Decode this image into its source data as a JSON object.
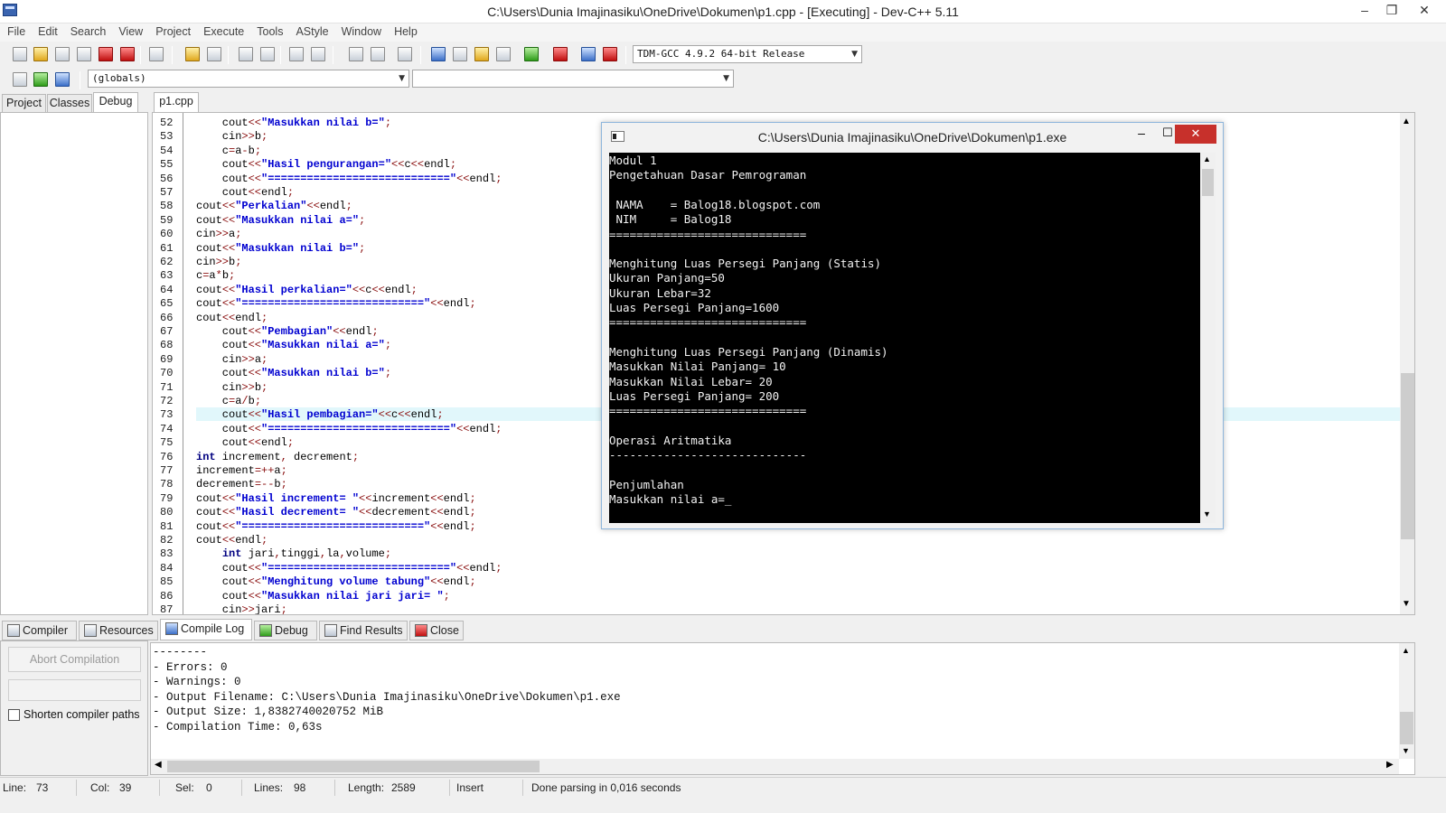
{
  "window": {
    "title": "C:\\Users\\Dunia Imajinasiku\\OneDrive\\Dokumen\\p1.cpp - [Executing] - Dev-C++ 5.11"
  },
  "menu": [
    "File",
    "Edit",
    "Search",
    "View",
    "Project",
    "Execute",
    "Tools",
    "AStyle",
    "Window",
    "Help"
  ],
  "toolbar": {
    "compiler_select": "TDM-GCC 4.9.2 64-bit Release",
    "scope_select": "(globals)",
    "symbol_select": ""
  },
  "left_tabs": [
    "Project",
    "Classes",
    "Debug"
  ],
  "editor": {
    "file_tab": "p1.cpp",
    "line_numbers": [
      "52",
      "53",
      "54",
      "55",
      "56",
      "57",
      "58",
      "59",
      "60",
      "61",
      "62",
      "63",
      "64",
      "65",
      "66",
      "67",
      "68",
      "69",
      "70",
      "71",
      "72",
      "73",
      "74",
      "75",
      "76",
      "77",
      "78",
      "79",
      "80",
      "81",
      "82",
      "83",
      "84",
      "85",
      "86",
      "87"
    ],
    "lines": [
      "    cout<<\"Masukkan nilai b=\";",
      "    cin>>b;",
      "    c=a-b;",
      "    cout<<\"Hasil pengurangan=\"<<c<<endl;",
      "    cout<<\"============================\"<<endl;",
      "    cout<<endl;",
      "cout<<\"Perkalian\"<<endl;",
      "cout<<\"Masukkan nilai a=\";",
      "cin>>a;",
      "cout<<\"Masukkan nilai b=\";",
      "cin>>b;",
      "c=a*b;",
      "cout<<\"Hasil perkalian=\"<<c<<endl;",
      "cout<<\"============================\"<<endl;",
      "cout<<endl;",
      "    cout<<\"Pembagian\"<<endl;",
      "    cout<<\"Masukkan nilai a=\";",
      "    cin>>a;",
      "    cout<<\"Masukkan nilai b=\";",
      "    cin>>b;",
      "    c=a/b;",
      "    cout<<\"Hasil pembagian=\"<<c<<endl;",
      "    cout<<\"============================\"<<endl;",
      "    cout<<endl;",
      "int increment, decrement;",
      "increment=++a;",
      "decrement=--b;",
      "cout<<\"Hasil increment= \"<<increment<<endl;",
      "cout<<\"Hasil decrement= \"<<decrement<<endl;",
      "cout<<\"============================\"<<endl;",
      "cout<<endl;",
      "    int jari,tinggi,la,volume;",
      "    cout<<\"============================\"<<endl;",
      "    cout<<\"Menghitung volume tabung\"<<endl;",
      "    cout<<\"Masukkan nilai jari jari= \";",
      "    cin>>jari;"
    ]
  },
  "console": {
    "title": "C:\\Users\\Dunia Imajinasiku\\OneDrive\\Dokumen\\p1.exe",
    "lines": [
      "Modul 1",
      "Pengetahuan Dasar Pemrograman",
      "",
      " NAMA    = Balog18.blogspot.com",
      " NIM     = Balog18",
      "=============================",
      "",
      "Menghitung Luas Persegi Panjang (Statis)",
      "Ukuran Panjang=50",
      "Ukuran Lebar=32",
      "Luas Persegi Panjang=1600",
      "=============================",
      "",
      "Menghitung Luas Persegi Panjang (Dinamis)",
      "Masukkan Nilai Panjang= 10",
      "Masukkan Nilai Lebar= 20",
      "Luas Persegi Panjang= 200",
      "=============================",
      "",
      "Operasi Aritmatika",
      "-----------------------------",
      "",
      "Penjumlahan",
      "Masukkan nilai a=_"
    ]
  },
  "bottom_tabs": [
    "Compiler",
    "Resources",
    "Compile Log",
    "Debug",
    "Find Results",
    "Close"
  ],
  "compile_panel": {
    "abort_label": "Abort Compilation",
    "shorten_label": "Shorten compiler paths"
  },
  "compile_log": [
    "--------",
    "- Errors: 0",
    "- Warnings: 0",
    "- Output Filename: C:\\Users\\Dunia Imajinasiku\\OneDrive\\Dokumen\\p1.exe",
    "- Output Size: 1,8382740020752 MiB",
    "- Compilation Time: 0,63s"
  ],
  "status": {
    "line_label": "Line:",
    "line": "73",
    "col_label": "Col:",
    "col": "39",
    "sel_label": "Sel:",
    "sel": "0",
    "lines_label": "Lines:",
    "lines": "98",
    "length_label": "Length:",
    "length": "2589",
    "mode": "Insert",
    "message": "Done parsing in 0,016 seconds"
  },
  "colors": {
    "highlight": "#e1f7fb",
    "console_bg": "#000000",
    "close_red": "#c7302b",
    "string_blue": "#0000d0"
  }
}
